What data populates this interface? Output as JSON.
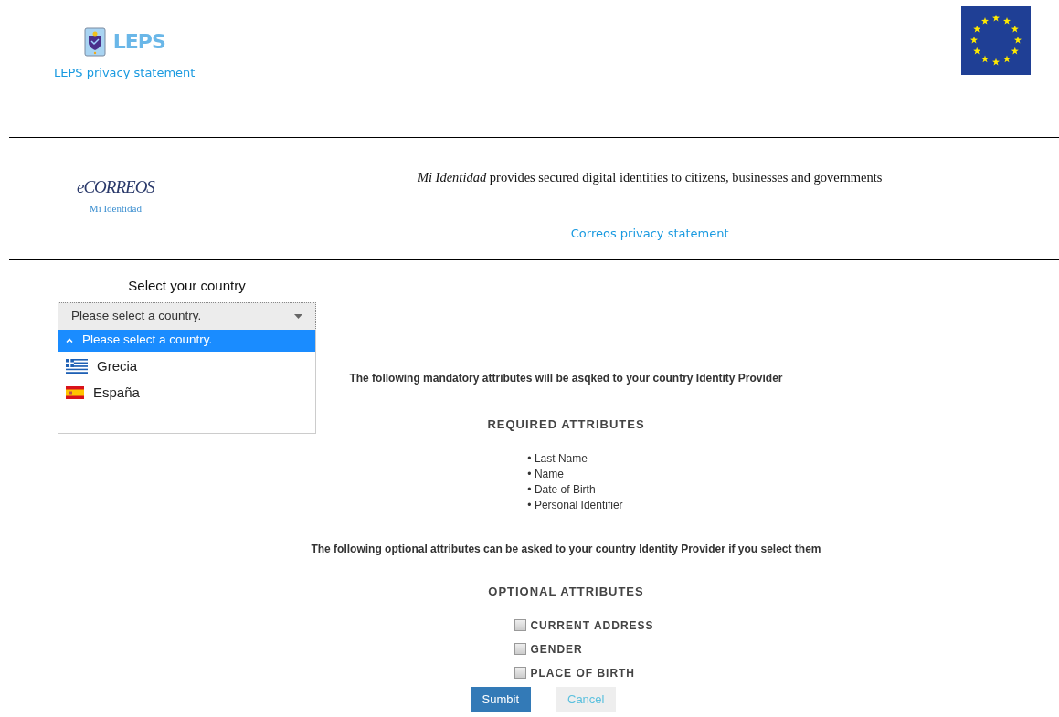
{
  "header": {
    "logo_text": "LEPS",
    "privacy_link": "LEPS privacy statement"
  },
  "provider": {
    "logo_text": "eCORREOS",
    "logo_subtitle": "Mi Identidad",
    "tagline": "*Mi Identidad* provides secured digital identities to citizens, businesses and governments",
    "privacy_link": "Correos privacy statement"
  },
  "country": {
    "label": "Select your country",
    "value": "Please select a country.",
    "expanded": true,
    "options": [
      {
        "label": "Please select a country.",
        "kind": "placeholder",
        "selected": true
      },
      {
        "label": "Grecia",
        "kind": "greece",
        "selected": false
      },
      {
        "label": "España",
        "kind": "spain",
        "selected": false
      }
    ]
  },
  "mandatory_note": "The following mandatory attributes will be asqked to your country Identity Provider",
  "required_heading": "REQUIRED ATTRIBUTES",
  "required": [
    "• Last Name",
    "• Name",
    "• Date of Birth",
    "• Personal Identifier"
  ],
  "optional_note": "The following optional attributes can be asked to your country Identity Provider if you select them",
  "optional_heading": "OPTIONAL ATTRIBUTES",
  "optional": [
    {
      "label": "CURRENT ADDRESS",
      "checked": false
    },
    {
      "label": "GENDER",
      "checked": false
    },
    {
      "label": "PLACE OF BIRTH",
      "checked": false
    }
  ],
  "buttons": [
    {
      "label": "Sumbit",
      "kind": "primary"
    },
    {
      "label": "Cancel",
      "kind": "secondary"
    }
  ]
}
